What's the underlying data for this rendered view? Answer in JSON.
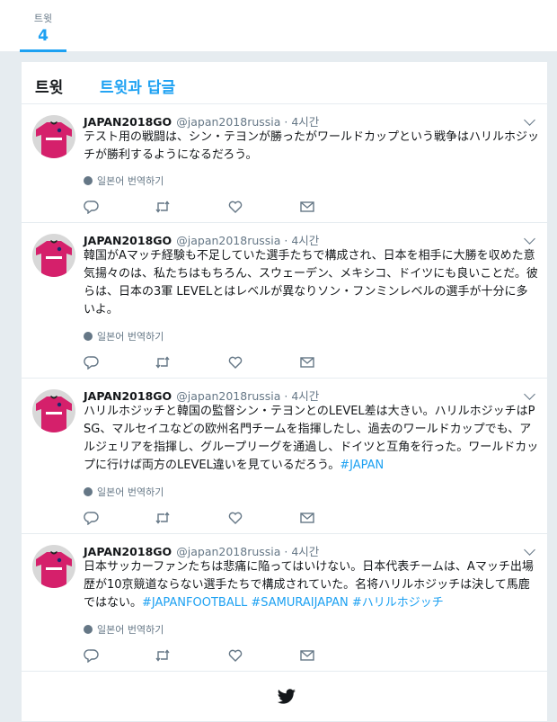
{
  "stats": {
    "tweets_label": "트윗",
    "tweets_value": "4"
  },
  "tabs": [
    {
      "label": "트윗"
    },
    {
      "label": "트윗과 답글"
    }
  ],
  "icons": {
    "globe": "globe-icon",
    "reply": "reply-icon",
    "retweet": "retweet-icon",
    "like": "heart-icon",
    "dm": "envelope-icon",
    "caret": "chevron-down-icon",
    "bird": "twitter-bird-icon"
  },
  "colors": {
    "accent": "#1da1f2",
    "muted": "#657786",
    "background": "#e6ecf0"
  },
  "tweets": [
    {
      "name": "JAPAN2018GO",
      "handle": "@japan2018russia · 4시간",
      "text": "テスト用の戦闘は、シン・テヨンが勝ったがワールドカップという戦争はハリルホジッチが勝利するようになるだろう。",
      "hashtags": "",
      "translate": "일본어 번역하기"
    },
    {
      "name": "JAPAN2018GO",
      "handle": "@japan2018russia · 4시간",
      "text": "韓国がAマッチ経験も不足していた選手たちで構成され、日本を相手に大勝を収めた意気揚々のは、私たちはもちろん、スウェーデン、メキシコ、ドイツにも良いことだ。彼らは、日本の3軍 LEVELとはレベルが異なりソン・フンミンレベルの選手が十分に多いよ。",
      "hashtags": "",
      "translate": "일본어 번역하기"
    },
    {
      "name": "JAPAN2018GO",
      "handle": "@japan2018russia · 4시간",
      "text": "ハリルホジッチと韓国の監督シン・テヨンとのLEVEL差は大きい。ハリルホジッチはPSG、マルセイユなどの欧州名門チームを指揮したし、過去のワールドカップでも、アルジェリアを指揮し、グループリーグを通過し、ドイツと互角を行った。ワールドカップに行けば両方のLEVEL違いを見ているだろう。",
      "hashtags": "#JAPAN",
      "translate": "일본어 번역하기"
    },
    {
      "name": "JAPAN2018GO",
      "handle": "@japan2018russia · 4시간",
      "text": "日本サッカーファンたちは悲痛に陥ってはいけない。日本代表チームは、Aマッチ出場歴が10京競道ならない選手たちで構成されていた。名将ハリルホジッチは決して馬鹿ではない。",
      "hashtags": "#JAPANFOOTBALL #SAMURAIJAPAN #ハリルホジッチ",
      "translate": "일본어 번역하기"
    }
  ]
}
